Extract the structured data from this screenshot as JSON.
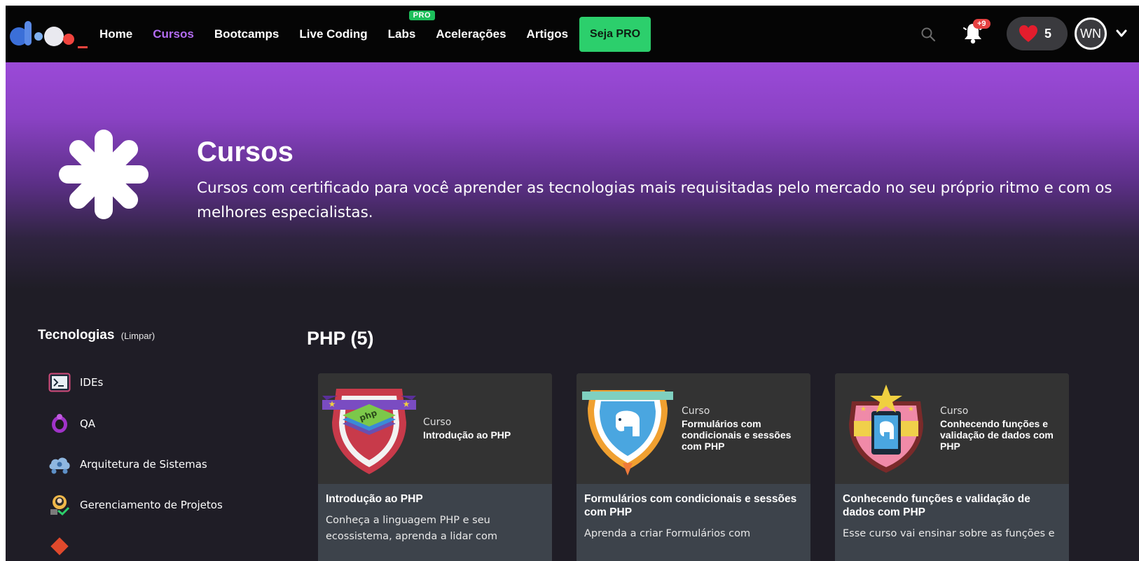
{
  "nav": {
    "links": [
      {
        "label": "Home",
        "active": false
      },
      {
        "label": "Cursos",
        "active": true
      },
      {
        "label": "Bootcamps",
        "active": false
      },
      {
        "label": "Live Coding",
        "active": false
      },
      {
        "label": "Labs",
        "active": false
      },
      {
        "label": "Acelerações",
        "active": false
      },
      {
        "label": "Artigos",
        "active": false
      }
    ],
    "labs_badge": "PRO",
    "cta": "Seja PRO",
    "notification_count": "+9",
    "likes_count": "5",
    "avatar_initials": "WN"
  },
  "hero": {
    "title": "Cursos",
    "description": "Cursos com certificado para você aprender as tecnologias mais requisitadas pelo mercado no seu próprio ritmo e com os melhores especialistas."
  },
  "sidebar": {
    "title": "Tecnologias",
    "clear": "(Limpar)",
    "items": [
      {
        "label": "IDEs",
        "icon": "terminal-icon"
      },
      {
        "label": "QA",
        "icon": "bug-icon"
      },
      {
        "label": "Arquitetura de Sistemas",
        "icon": "cloud-network-icon"
      },
      {
        "label": "Gerenciamento de Projetos",
        "icon": "project-manager-icon"
      }
    ]
  },
  "main": {
    "section_title": "PHP (5)",
    "cards": [
      {
        "kind": "Curso",
        "badge_name": "Introdução ao PHP",
        "title": "Introdução ao PHP",
        "desc": "Conheça a linguagem PHP e seu ecossistema, aprenda a lidar com",
        "badge_color": "#c83a4a"
      },
      {
        "kind": "Curso",
        "badge_name": "Formulários com condicionais e sessões com PHP",
        "title": "Formulários com condicionais e sessões com PHP",
        "desc": "Aprenda a criar Formulários com",
        "badge_color": "#4aa6e0"
      },
      {
        "kind": "Curso",
        "badge_name": "Conhecendo funções e validação de dados com PHP",
        "title": "Conhecendo funções e validação de dados com PHP",
        "desc": "Esse curso vai ensinar sobre as funções e",
        "badge_color": "#f08aa8"
      }
    ]
  },
  "colors": {
    "accent": "#b36cf2",
    "cta": "#2ccf6c",
    "notification": "#e64141"
  }
}
